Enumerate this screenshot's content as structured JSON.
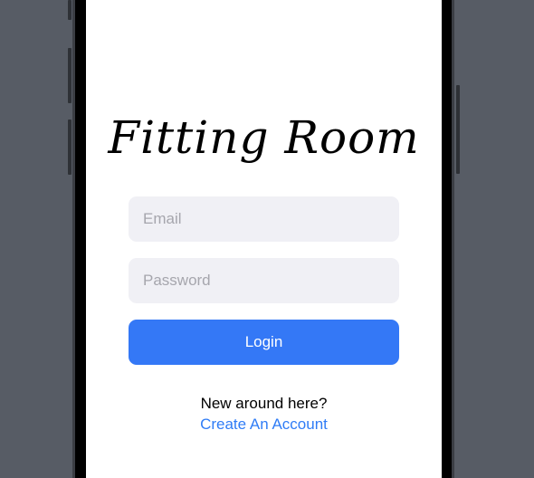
{
  "app": {
    "title": "Fitting Room"
  },
  "login_form": {
    "email_placeholder": "Email",
    "email_value": "",
    "password_placeholder": "Password",
    "password_value": "",
    "login_label": "Login"
  },
  "signup": {
    "prompt": "New around here?",
    "link_label": "Create An Account"
  },
  "colors": {
    "accent": "#3478f6",
    "link": "#2f7cf6",
    "field_background": "#f0f0f5",
    "backdrop": "#575c65"
  }
}
